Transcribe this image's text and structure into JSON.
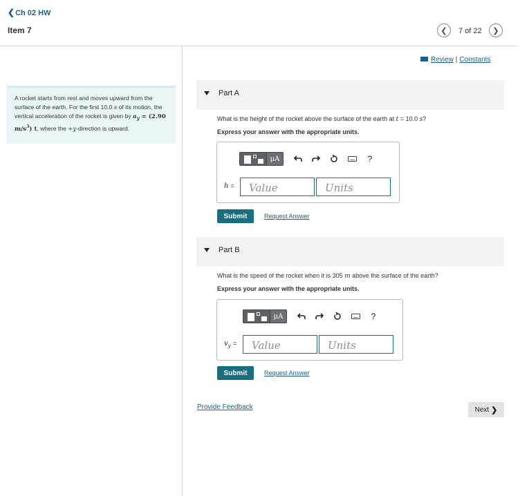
{
  "header": {
    "back_link": "Ch 02 HW",
    "item_title": "Item 7",
    "page_counter": "7 of 22"
  },
  "links": {
    "review": "Review",
    "separator": "|",
    "constants": "Constants"
  },
  "problem": {
    "text_1": "A rocket starts from rest and moves upward from the surface of the earth. For the first 10.0",
    "unit_s": "s",
    "text_2": "of its motion, the vertical acceleration of the rocket is given by",
    "accel_var": "a",
    "accel_sub": "y",
    "accel_eq": "= (2.90 m/s",
    "accel_exp": "3",
    "accel_close": ") t",
    "text_3": ", where the",
    "dir": "+y",
    "text_4": "-direction is upward."
  },
  "partA": {
    "label": "Part A",
    "question_1": "What is the height of the rocket above the surface of the earth at",
    "question_var": "t",
    "question_2": "= 10.0",
    "question_unit": "s",
    "question_end": "?",
    "instruction": "Express your answer with the appropriate units.",
    "var_label": "h",
    "eq": "=",
    "value_placeholder": "Value",
    "units_placeholder": "Units",
    "units_btn": "μA",
    "help": "?",
    "submit": "Submit",
    "request": "Request Answer"
  },
  "partB": {
    "label": "Part B",
    "question_1": "What is the speed of the rocket when it is 305",
    "question_unit": "m",
    "question_2": "above the surface of the earth?",
    "instruction": "Express your answer with the appropriate units.",
    "var_label": "v",
    "var_sub": "y",
    "eq": "=",
    "value_placeholder": "Value",
    "units_placeholder": "Units",
    "units_btn": "μA",
    "help": "?",
    "submit": "Submit",
    "request": "Request Answer"
  },
  "footer": {
    "feedback": "Provide Feedback",
    "next": "Next"
  },
  "colors": {
    "accent": "#1b6e7e",
    "link": "#1b5e8f",
    "problem_bg": "#e9f5f6",
    "part_bar_bg": "#f3f3f3"
  },
  "icons": [
    "chevron-left-icon",
    "chevron-right-icon",
    "book-icon",
    "templates-icon",
    "undo-icon",
    "redo-icon",
    "reset-icon",
    "keyboard-icon",
    "help-icon",
    "collapse-triangle-icon"
  ]
}
